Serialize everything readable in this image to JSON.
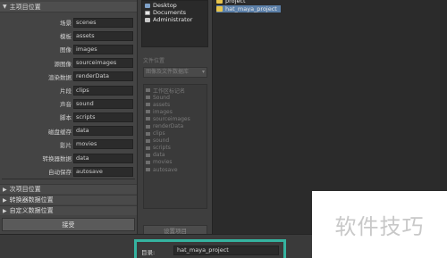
{
  "left_panel": {
    "main_project_header": "主项目位置",
    "rows": [
      {
        "label": "场景",
        "value": "scenes"
      },
      {
        "label": "模板",
        "value": "assets"
      },
      {
        "label": "图像",
        "value": "images"
      },
      {
        "label": "源图像",
        "value": "sourceimages"
      },
      {
        "label": "渲染数据",
        "value": "renderData"
      },
      {
        "label": "片段",
        "value": "clips"
      },
      {
        "label": "声音",
        "value": "sound"
      },
      {
        "label": "脚本",
        "value": "scripts"
      },
      {
        "label": "磁盘缓存",
        "value": "data"
      },
      {
        "label": "影片",
        "value": "movies"
      },
      {
        "label": "转换器数据",
        "value": "data"
      },
      {
        "label": "自动保存",
        "value": "autosave"
      }
    ],
    "collapsed_sections": [
      "次项目位置",
      "转换器数据位置",
      "自定义数据位置"
    ],
    "bottom_button": "接受"
  },
  "middle_panel": {
    "directories": [
      {
        "label": "Desktop",
        "icon": "desktop-icon"
      },
      {
        "label": "Documents",
        "icon": "document-icon"
      },
      {
        "label": "Administrator",
        "icon": "user-icon"
      }
    ],
    "folder_label": "文件位置",
    "select_value": "图像及文件数据库",
    "folders": [
      "工作区标记名",
      "Sound",
      "assets",
      "images",
      "sourceimages",
      "renderData",
      "clips",
      "sound",
      "scripts",
      "data",
      "movies",
      "autosave"
    ],
    "button": "设置项目"
  },
  "right_panel": {
    "items": [
      {
        "label": "project",
        "selected": false
      },
      {
        "label": "hat_maya_project",
        "selected": true
      }
    ]
  },
  "bottom_bar": {
    "filename_label": "目录:",
    "filename_value": "hat_maya_project"
  },
  "watermark": {
    "text": "软件技巧"
  },
  "colors": {
    "highlight_frame": "#35b3a0",
    "selection": "#5b7fa8",
    "folder": "#e7c44b"
  }
}
